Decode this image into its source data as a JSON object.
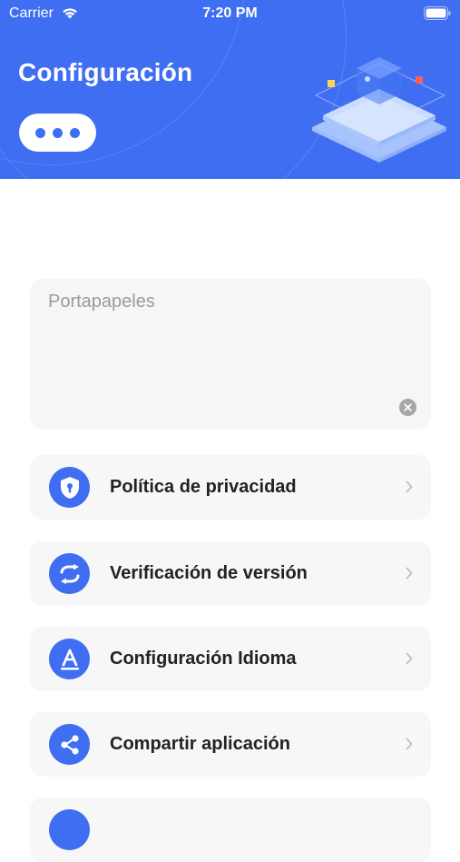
{
  "status_bar": {
    "carrier": "Carrier",
    "time": "7:20 PM"
  },
  "header": {
    "title": "Configuración"
  },
  "clipboard": {
    "placeholder": "Portapapeles",
    "value": ""
  },
  "menu": {
    "items": [
      {
        "label": "Política de privacidad",
        "icon": "shield-icon"
      },
      {
        "label": "Verificación de versión",
        "icon": "refresh-icon"
      },
      {
        "label": "Configuración Idioma",
        "icon": "font-a-icon"
      },
      {
        "label": "Compartir aplicación",
        "icon": "share-icon"
      },
      {
        "label": "",
        "icon": "partial-icon"
      }
    ]
  },
  "colors": {
    "accent": "#3f6ef2",
    "card_bg": "#f7f7f7",
    "text": "#222222"
  }
}
